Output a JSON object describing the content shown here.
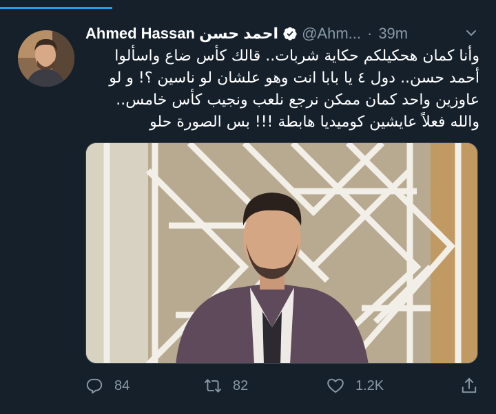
{
  "author": {
    "name": "Ahmed Hassan احمد حسن",
    "handle": "@Ahm...",
    "separator": "·",
    "time": "39m"
  },
  "tweet": {
    "lines": [
      "وأنا كمان هحكيلكم حكاية شربات.. قالك كأس ضاع واسألوا",
      "أحمد حسن.. دول ٤ يا بابا انت وهو  علشان لو ناسين ؟! و لو",
      "عاوزين واحد كمان ممكن نرجع نلعب ونجيب كأس خامس..",
      "والله فعلاً عايشين كوميديا هابطة !!! بس الصورة حلو"
    ]
  },
  "actions": {
    "reply_count": "84",
    "retweet_count": "82",
    "like_count": "1.2K"
  },
  "icons": {
    "verified": "verified-badge-icon",
    "more": "chevron-down-icon",
    "reply": "reply-icon",
    "retweet": "retweet-icon",
    "like": "heart-icon",
    "share": "share-icon"
  },
  "colors": {
    "background": "#15202b",
    "accent": "#1da1f2",
    "muted": "#8899a6",
    "text": "#ffffff"
  }
}
